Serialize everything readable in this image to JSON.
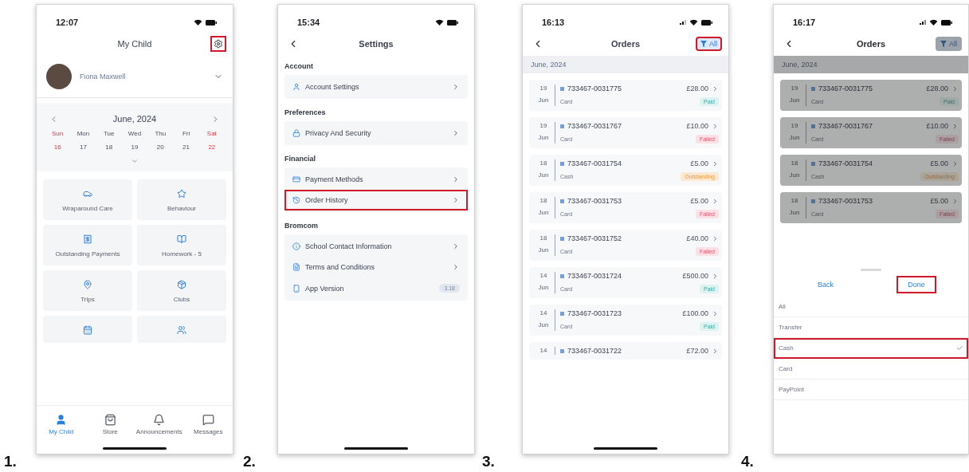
{
  "panels": [
    {
      "label": "1.",
      "kind": "child",
      "time": "12:07",
      "signal": false,
      "title": "My Child",
      "settings_highlighted": true,
      "child": {
        "name": "Fiona Maxwell"
      },
      "calendar": {
        "month": "June, 2024",
        "weekdays": [
          {
            "text": "Sun",
            "weekend": true
          },
          {
            "text": "Mon",
            "weekend": false
          },
          {
            "text": "Tue",
            "weekend": false
          },
          {
            "text": "Wed",
            "weekend": false
          },
          {
            "text": "Thu",
            "weekend": false
          },
          {
            "text": "Fri",
            "weekend": false
          },
          {
            "text": "Sat",
            "weekend": true
          }
        ],
        "dates": [
          {
            "text": "16",
            "weekend": true
          },
          {
            "text": "17",
            "weekend": false
          },
          {
            "text": "18",
            "weekend": false
          },
          {
            "text": "19",
            "weekend": false
          },
          {
            "text": "20",
            "weekend": false
          },
          {
            "text": "21",
            "weekend": false
          },
          {
            "text": "22",
            "weekend": true
          }
        ]
      },
      "tiles": [
        {
          "kind": "full",
          "label": "Wraparound Care"
        },
        {
          "kind": "full",
          "label": "Behaviour"
        },
        {
          "kind": "full",
          "label": "Outstanding Payments"
        },
        {
          "kind": "full",
          "label": "Homework - 5"
        },
        {
          "kind": "full",
          "label": "Trips"
        },
        {
          "kind": "full",
          "label": "Clubs"
        },
        {
          "kind": "cut"
        },
        {
          "kind": "cut"
        }
      ],
      "tabs": [
        {
          "label": "My Child",
          "selected": true
        },
        {
          "label": "Store",
          "selected": false
        },
        {
          "label": "Announcements",
          "selected": false
        },
        {
          "label": "Messages",
          "selected": false
        }
      ]
    },
    {
      "label": "2.",
      "kind": "settings",
      "time": "15:34",
      "signal": false,
      "title": "Settings",
      "sections": [
        {
          "title": "Account",
          "items": [
            {
              "label": "Account Settings",
              "highlighted": false
            }
          ]
        },
        {
          "title": "Preferences",
          "items": [
            {
              "label": "Privacy And Security",
              "highlighted": false
            }
          ]
        },
        {
          "title": "Financial",
          "items": [
            {
              "label": "Payment Methods",
              "highlighted": false
            },
            {
              "label": "Order History",
              "highlighted": true
            }
          ]
        },
        {
          "title": "Bromcom",
          "items": [
            {
              "label": "School Contact Information",
              "highlighted": false
            },
            {
              "label": "Terms and Conditions",
              "highlighted": false
            },
            {
              "label": "App Version",
              "badge": "3.18",
              "highlighted": false
            }
          ]
        }
      ]
    },
    {
      "label": "3.",
      "kind": "orders",
      "time": "16:13",
      "signal": true,
      "title": "Orders",
      "filter": {
        "label": "All",
        "highlighted": true
      },
      "month": "June, 2024",
      "orders": [
        {
          "day": "19",
          "month": "Jun",
          "id": "733467-0031775",
          "amount": "£28.00",
          "method": "Card",
          "status": {
            "label": "Paid",
            "kind": "paid"
          }
        },
        {
          "day": "19",
          "month": "Jun",
          "id": "733467-0031767",
          "amount": "£10.00",
          "method": "Card",
          "status": {
            "label": "Failed",
            "kind": "failed"
          }
        },
        {
          "day": "18",
          "month": "Jun",
          "id": "733467-0031754",
          "amount": "£5.00",
          "method": "Cash",
          "status": {
            "label": "Outstanding",
            "kind": "outstanding"
          }
        },
        {
          "day": "18",
          "month": "Jun",
          "id": "733467-0031753",
          "amount": "£5.00",
          "method": "Card",
          "status": {
            "label": "Failed",
            "kind": "failed"
          }
        },
        {
          "day": "18",
          "month": "Jun",
          "id": "733467-0031752",
          "amount": "£40.00",
          "method": "Card",
          "status": {
            "label": "Failed",
            "kind": "failed"
          }
        },
        {
          "day": "14",
          "month": "Jun",
          "id": "733467-0031724",
          "amount": "£500.00",
          "method": "Card",
          "status": {
            "label": "Paid",
            "kind": "paid"
          }
        },
        {
          "day": "14",
          "month": "Jun",
          "id": "733467-0031723",
          "amount": "£100.00",
          "method": "Card",
          "status": {
            "label": "Paid",
            "kind": "paid"
          }
        },
        {
          "day": "14",
          "id": "733467-0031722",
          "amount": "£72.00"
        }
      ]
    },
    {
      "label": "4.",
      "kind": "orders",
      "time": "16:17",
      "signal": true,
      "title": "Orders",
      "filter": {
        "label": "All",
        "highlighted": false
      },
      "month": "June, 2024",
      "orders": [
        {
          "day": "19",
          "month": "Jun",
          "id": "733467-0031775",
          "amount": "£28.00",
          "method": "Card",
          "status": {
            "label": "Paid",
            "kind": "paid"
          }
        },
        {
          "day": "19",
          "month": "Jun",
          "id": "733467-0031767",
          "amount": "£10.00",
          "method": "Card",
          "status": {
            "label": "Failed",
            "kind": "failed"
          }
        },
        {
          "day": "18",
          "month": "Jun",
          "id": "733467-0031754",
          "amount": "£5.00",
          "method": "Cash",
          "status": {
            "label": "Outstanding",
            "kind": "outstanding"
          }
        },
        {
          "day": "18",
          "month": "Jun",
          "id": "733467-0031753",
          "amount": "£5.00",
          "method": "Card",
          "status": {
            "label": "Failed",
            "kind": "failed"
          }
        }
      ],
      "sheet": {
        "back": "Back",
        "done": "Done",
        "done_highlighted": true,
        "options": [
          {
            "label": "All",
            "selected": false,
            "highlighted": false
          },
          {
            "label": "Transfer",
            "selected": false,
            "highlighted": false
          },
          {
            "label": "Cash",
            "selected": true,
            "highlighted": true
          },
          {
            "label": "Card",
            "selected": false,
            "highlighted": false
          },
          {
            "label": "PayPoint",
            "selected": false,
            "highlighted": false
          }
        ]
      }
    }
  ]
}
